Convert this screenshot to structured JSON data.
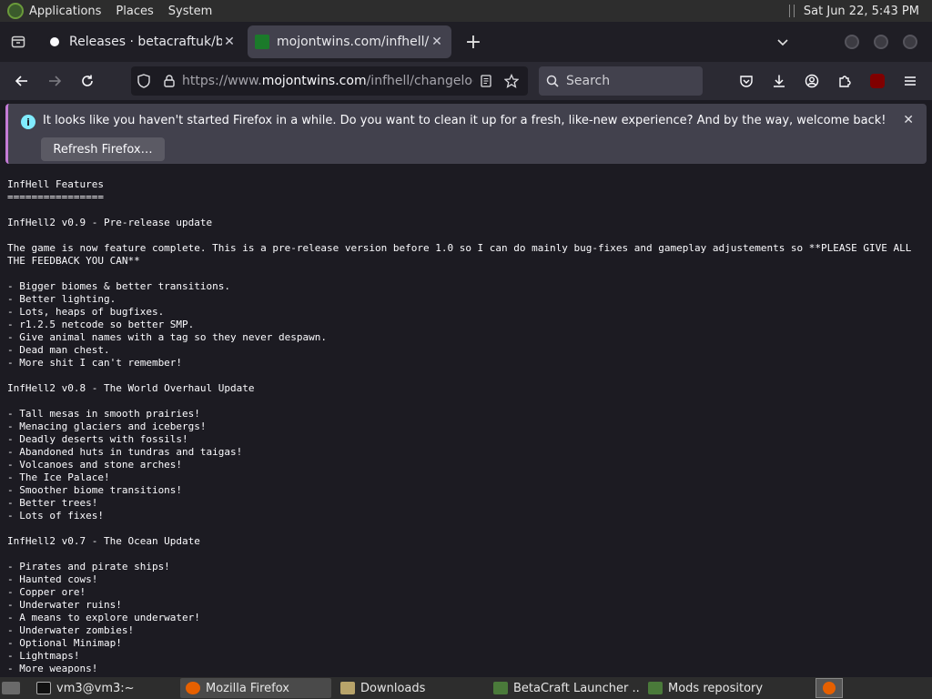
{
  "topbar": {
    "menus": [
      "Applications",
      "Places",
      "System"
    ],
    "datetime": "Sat Jun 22,  5:43 PM"
  },
  "tabs": [
    {
      "title": "Releases · betacraftuk/betacra",
      "active": false
    },
    {
      "title": "mojontwins.com/infhell/",
      "active": true
    }
  ],
  "navbar": {
    "url_prefix": "https://www.",
    "url_domain": "mojontwins.com",
    "url_path": "/infhell/changelog.txt",
    "search_placeholder": "Search"
  },
  "notification": {
    "message": "It looks like you haven't started Firefox in a while. Do you want to clean it up for a fresh, like-new experience? And by the way, welcome back!",
    "button": "Refresh Firefox…"
  },
  "page_text": "InfHell Features\n================\n\nInfHell2 v0.9 - Pre-release update\n\nThe game is now feature complete. This is a pre-release version before 1.0 so I can do mainly bug-fixes and gameplay adjustements so **PLEASE GIVE ALL THE FEEDBACK YOU CAN**\n\n- Bigger biomes & better transitions.\n- Better lighting.\n- Lots, heaps of bugfixes.\n- r1.2.5 netcode so better SMP.\n- Give animal names with a tag so they never despawn.\n- Dead man chest.\n- More shit I can't remember!\n\nInfHell2 v0.8 - The World Overhaul Update\n\n- Tall mesas in smooth prairies!\n- Menacing glaciers and icebergs!\n- Deadly deserts with fossils!\n- Abandoned huts in tundras and taigas!\n- Volcanoes and stone arches!\n- The Ice Palace!\n- Smoother biome transitions!\n- Better trees!\n- Lots of fixes!\n\nInfHell2 v0.7 - The Ocean Update\n\n- Pirates and pirate ships!\n- Haunted cows!\n- Copper ore!\n- Underwater ruins!\n- A means to explore underwater!\n- Underwater zombies!\n- Optional Minimap!\n- Lightmaps!\n- More weapons!",
  "taskbar": [
    {
      "label": "vm3@vm3:~",
      "active": false
    },
    {
      "label": "Mozilla Firefox",
      "active": true
    },
    {
      "label": "Downloads",
      "active": false
    },
    {
      "label": "BetaCraft Launcher ...",
      "active": false
    },
    {
      "label": "Mods repository",
      "active": false
    }
  ]
}
